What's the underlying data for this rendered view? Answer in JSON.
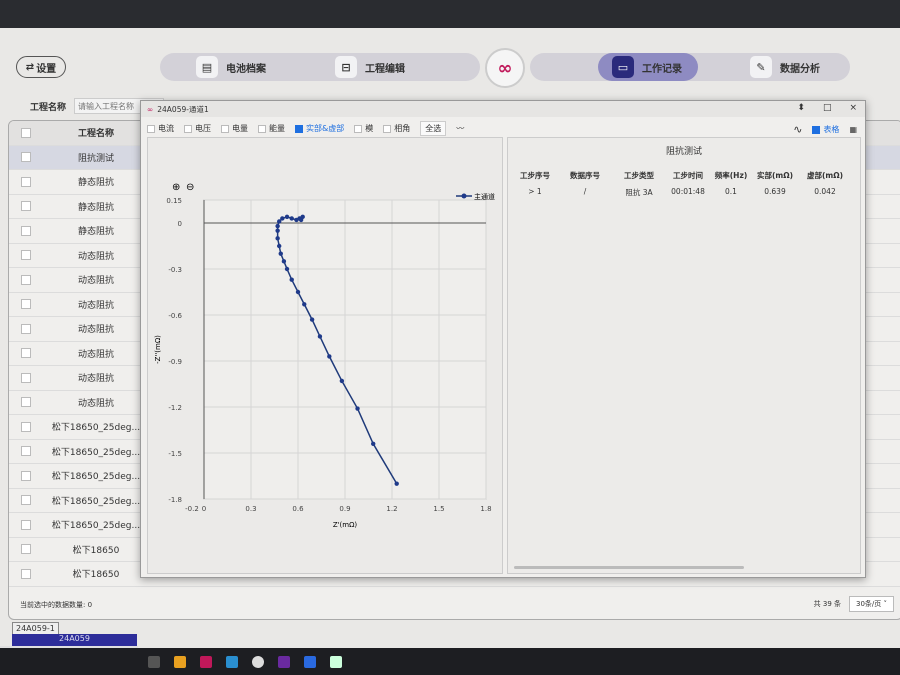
{
  "nav": {
    "settings": "设置",
    "items": [
      {
        "label": "电池档案",
        "icon": "document-icon"
      },
      {
        "label": "工程编辑",
        "icon": "inbox-icon"
      },
      {
        "label": "工作记录",
        "icon": "folder-icon",
        "active": true
      },
      {
        "label": "数据分析",
        "icon": "edit-icon"
      }
    ]
  },
  "filter": {
    "project_label": "工程名称",
    "project_placeholder": "请输入工程名称"
  },
  "table": {
    "header": "工程名称",
    "rows": [
      "阻抗测试",
      "静态阻抗",
      "静态阻抗",
      "静态阻抗",
      "动态阻抗",
      "动态阻抗",
      "动态阻抗",
      "动态阻抗",
      "动态阻抗",
      "动态阻抗",
      "动态阻抗",
      "松下18650_25deg...",
      "松下18650_25deg...",
      "松下18650_25deg...",
      "松下18650_25deg...",
      "松下18650_25deg...",
      "松下18650",
      "松下18650"
    ]
  },
  "status": "当前选中的数据数量: 0",
  "pager": {
    "total": "共 39 条",
    "page_size": "30条/页"
  },
  "bottom_tabs": [
    "24A059-1",
    "24A059"
  ],
  "dialog": {
    "title": "24A059-通道1",
    "options": [
      {
        "label": "电流",
        "checked": false
      },
      {
        "label": "电压",
        "checked": false
      },
      {
        "label": "电量",
        "checked": false
      },
      {
        "label": "能量",
        "checked": false
      },
      {
        "label": "实部&虚部",
        "checked": true
      },
      {
        "label": "模",
        "checked": false
      },
      {
        "label": "相角",
        "checked": false
      }
    ],
    "select_all": "全选",
    "table_toggle": "表格",
    "right_title": "阻抗测试",
    "columns": [
      "工步序号",
      "数据序号",
      "工步类型",
      "工步时间",
      "频率(Hz)",
      "实部(mΩ)",
      "虚部(mΩ)"
    ],
    "rows": [
      [
        "> 1",
        "/",
        "阻抗    3A",
        "00:01:48",
        "0.1",
        "0.639",
        "0.042"
      ]
    ]
  },
  "accent": "#2a2a7c",
  "chart_data": {
    "type": "scatter",
    "xlabel": "Z'(mΩ)",
    "ylabel": "-Z''(mΩ)",
    "xlim": [
      -0.2,
      1.8
    ],
    "ylim": [
      -1.8,
      0.15
    ],
    "xticks": [
      "-0.2",
      "0",
      "0.3",
      "0.6",
      "0.9",
      "1.2",
      "1.5",
      "1.8"
    ],
    "yticks": [
      "0.15",
      "0",
      "-0.3",
      "-0.6",
      "-0.9",
      "-1.2",
      "-1.5",
      "-1.8"
    ],
    "legend": "主通道",
    "legend_position": "top-right",
    "grid": true,
    "series": [
      {
        "name": "主通道",
        "x": [
          0.62,
          0.63,
          0.61,
          0.59,
          0.56,
          0.53,
          0.5,
          0.48,
          0.47,
          0.47,
          0.47,
          0.48,
          0.49,
          0.51,
          0.53,
          0.56,
          0.6,
          0.64,
          0.69,
          0.74,
          0.8,
          0.88,
          0.98,
          1.08,
          1.23
        ],
        "y": [
          0.02,
          0.04,
          0.03,
          0.02,
          0.03,
          0.04,
          0.03,
          0.01,
          -0.02,
          -0.05,
          -0.1,
          -0.15,
          -0.2,
          -0.25,
          -0.3,
          -0.37,
          -0.45,
          -0.53,
          -0.63,
          -0.74,
          -0.87,
          -1.03,
          -1.21,
          -1.44,
          -1.7
        ]
      }
    ]
  }
}
